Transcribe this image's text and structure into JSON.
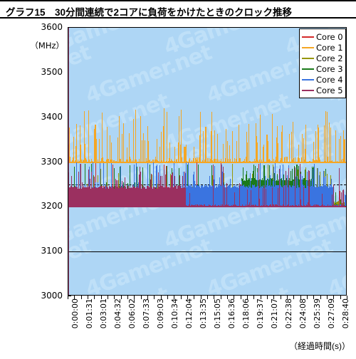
{
  "header": {
    "badge": "グラフ15",
    "title": "グラフ15　30分間連続で2コアに負荷をかけたときのクロック推移"
  },
  "chart_data": {
    "type": "line",
    "title": "グラフ15　30分間連続で2コアに負荷をかけたときのクロック推移",
    "subtitle": "",
    "xlabel": "（経過時間(s)）",
    "ylabel": "（MHz）",
    "ylim": [
      3000,
      3600
    ],
    "ytick_labels": [
      "3600",
      "3500",
      "3400",
      "3300",
      "3200",
      "3100",
      "3000"
    ],
    "ytick_values": [
      3600,
      3500,
      3400,
      3300,
      3200,
      3100,
      3000
    ],
    "grid": true,
    "gridlines_at": [
      3300,
      3100
    ],
    "dashed_gridline_at": 3250,
    "legend_position": "top-right",
    "xtick_labels": [
      "0:00:00",
      "0:01:31",
      "0:03:01",
      "0:04:32",
      "0:06:02",
      "0:07:33",
      "0:09:03",
      "0:10:34",
      "0:12:04",
      "0:13:35",
      "0:15:05",
      "0:16:36",
      "0:18:06",
      "0:19:37",
      "0:21:07",
      "0:22:38",
      "0:24:08",
      "0:25:39",
      "0:27:09",
      "0:28:40"
    ],
    "series": [
      {
        "name": "Core 0",
        "color": "#d42a2a",
        "baseline": 3200,
        "mean": 3205,
        "max": 3300,
        "min": 3200,
        "noise": 0.1,
        "spike_level": 3290,
        "spike_rate": 0.12,
        "seed": 11,
        "band": null
      },
      {
        "name": "Core 1",
        "color": "#f5a623",
        "baseline": 3300,
        "mean": 3310,
        "max": 3420,
        "min": 3200,
        "noise": 0.95,
        "spike_level": 3400,
        "spike_rate": 0.3,
        "seed": 23,
        "band": {
          "from": 0,
          "to": 1,
          "top": 3305
        }
      },
      {
        "name": "Core 2",
        "color": "#96960a",
        "baseline": 3200,
        "mean": 3206,
        "max": 3300,
        "min": 3200,
        "noise": 0.12,
        "spike_level": 3270,
        "spike_rate": 0.14,
        "seed": 37,
        "band": {
          "from": 0.82,
          "to": 1,
          "top": 3215
        }
      },
      {
        "name": "Core 3",
        "color": "#1a7a1a",
        "baseline": 3200,
        "mean": 3212,
        "max": 3300,
        "min": 3200,
        "noise": 0.18,
        "spike_level": 3280,
        "spike_rate": 0.16,
        "seed": 53,
        "band": {
          "from": 0.62,
          "to": 0.88,
          "top": 3265
        }
      },
      {
        "name": "Core 4",
        "color": "#3a74e0",
        "baseline": 3200,
        "mean": 3222,
        "max": 3300,
        "min": 3200,
        "noise": 0.3,
        "spike_level": 3285,
        "spike_rate": 0.22,
        "seed": 71,
        "band": {
          "from": 0.4,
          "to": 0.95,
          "top": 3250
        }
      },
      {
        "name": "Core 5",
        "color": "#9b3060",
        "baseline": 3200,
        "mean": 3220,
        "max": 3300,
        "min": 3200,
        "noise": 0.25,
        "spike_level": 3275,
        "spike_rate": 0.18,
        "seed": 97,
        "band": {
          "from": 0,
          "to": 0.42,
          "top": 3248
        }
      }
    ]
  },
  "legend": {
    "items": [
      {
        "label": "Core 0",
        "color": "#d42a2a"
      },
      {
        "label": "Core 1",
        "color": "#f5a623"
      },
      {
        "label": "Core 2",
        "color": "#96960a"
      },
      {
        "label": "Core 3",
        "color": "#1a7a1a"
      },
      {
        "label": "Core 4",
        "color": "#3a74e0"
      },
      {
        "label": "Core 5",
        "color": "#9b3060"
      }
    ]
  },
  "watermark": {
    "text": "4Gamer.net",
    "color": "#bfe0f8"
  }
}
